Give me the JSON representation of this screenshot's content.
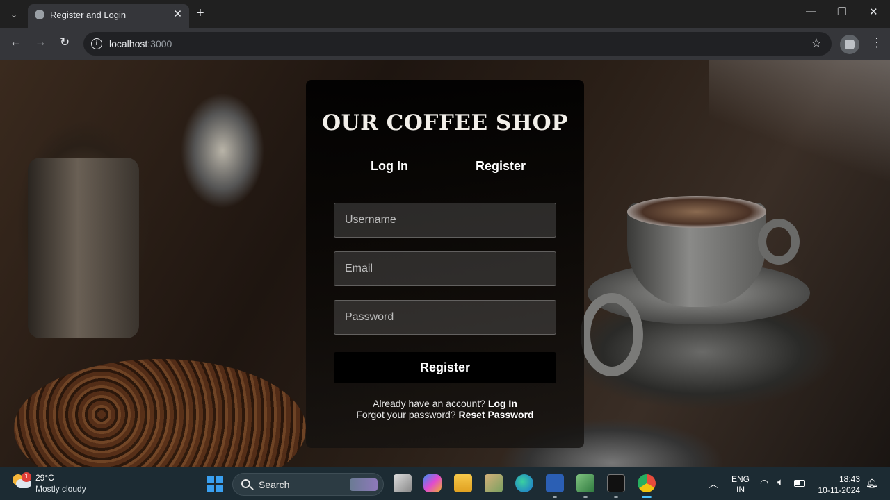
{
  "browser": {
    "tab_title": "Register and Login",
    "tab_close": "✕",
    "new_tab": "+",
    "url_host": "localhost",
    "url_port": ":3000",
    "win_minimize": "—",
    "win_restore": "❐",
    "win_close": "✕"
  },
  "page": {
    "brand": "OUR COFFEE SHOP",
    "tabs": [
      "Log In",
      "Register"
    ],
    "fields": {
      "username_placeholder": "Username",
      "email_placeholder": "Email",
      "password_placeholder": "Password"
    },
    "submit_label": "Register",
    "account_prompt": "Already have an account?",
    "account_link": "Log In",
    "forgot_prompt": "Forgot your password?",
    "forgot_link": "Reset Password"
  },
  "taskbar": {
    "weather_badge": "1",
    "temperature": "29°C",
    "condition": "Mostly cloudy",
    "search_label": "Search",
    "lang_line1": "ENG",
    "lang_line2": "IN",
    "time": "18:43",
    "date": "10-11-2024",
    "apps": [
      "file-explorer-icon",
      "copilot-icon",
      "folder-icon",
      "package-icon",
      "edge-icon",
      "word-icon",
      "notepad-icon",
      "terminal-icon",
      "chrome-icon"
    ]
  }
}
